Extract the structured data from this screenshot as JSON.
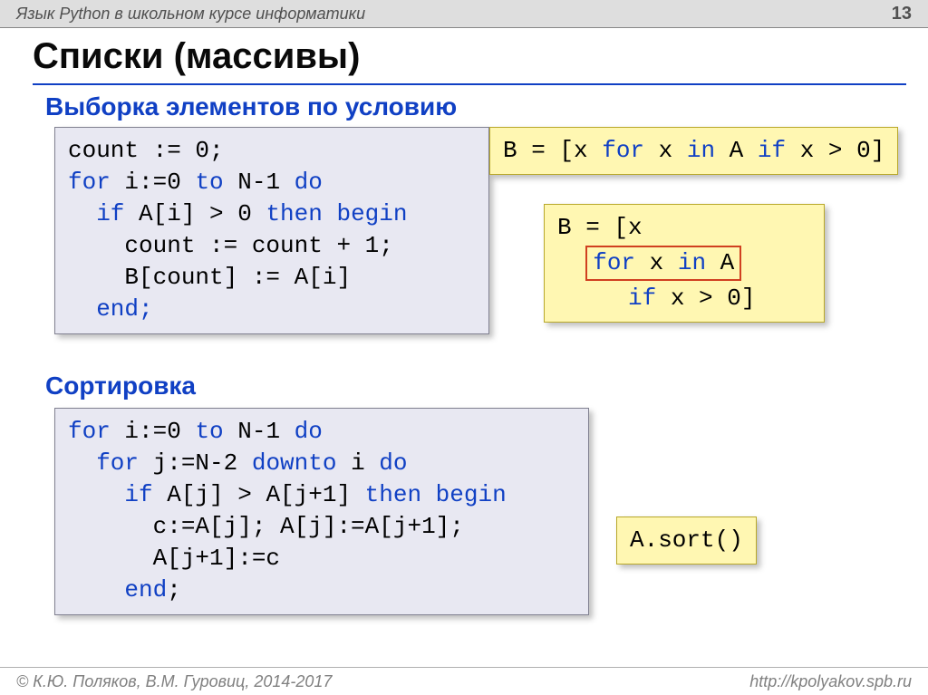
{
  "topbar_title": "Язык Python в школьном курсе информатики",
  "page_number": "13",
  "main_title": "Списки (массивы)",
  "section1_title": "Выборка элементов по условию",
  "section2_title": "Сортировка",
  "pascal1": {
    "l1a": "count := 0;",
    "l2a": "for",
    "l2b": " i:=0 ",
    "l2c": "to",
    "l2d": " N-1 ",
    "l2e": "do",
    "l3a": "  if",
    "l3b": " A[i] > 0 ",
    "l3c": "then begin",
    "l4": "    count := count + 1;",
    "l5": "    B[count] := A[i]",
    "l6": "  end;"
  },
  "py1": {
    "a": "B = [x ",
    "b": "for",
    "c": " x ",
    "d": "in",
    "e": " A ",
    "f": "if",
    "g": " x > 0]"
  },
  "py1_multi": {
    "l1": "B = [x",
    "hl_a": "for",
    "hl_b": " x ",
    "hl_c": "in",
    "hl_d": " A",
    "l3a": "     if",
    "l3b": " x > 0]"
  },
  "pascal2": {
    "l1a": "for",
    "l1b": " i:=0 ",
    "l1c": "to",
    "l1d": " N-1 ",
    "l1e": "do",
    "l2a": "  for",
    "l2b": " j:=N-2 ",
    "l2c": "downto",
    "l2d": " i ",
    "l2e": "do",
    "l3a": "    if",
    "l3b": " A[j] > A[j+1] ",
    "l3c": "then begin",
    "l4": "      c:=A[j]; A[j]:=A[j+1];",
    "l5": "      A[j+1]:=c",
    "l6a": "    end",
    "l6b": ";"
  },
  "py2": "A.sort()",
  "footer_left": "© К.Ю. Поляков, В.М. Гуровиц, 2014-2017",
  "footer_right": "http://kpolyakov.spb.ru"
}
